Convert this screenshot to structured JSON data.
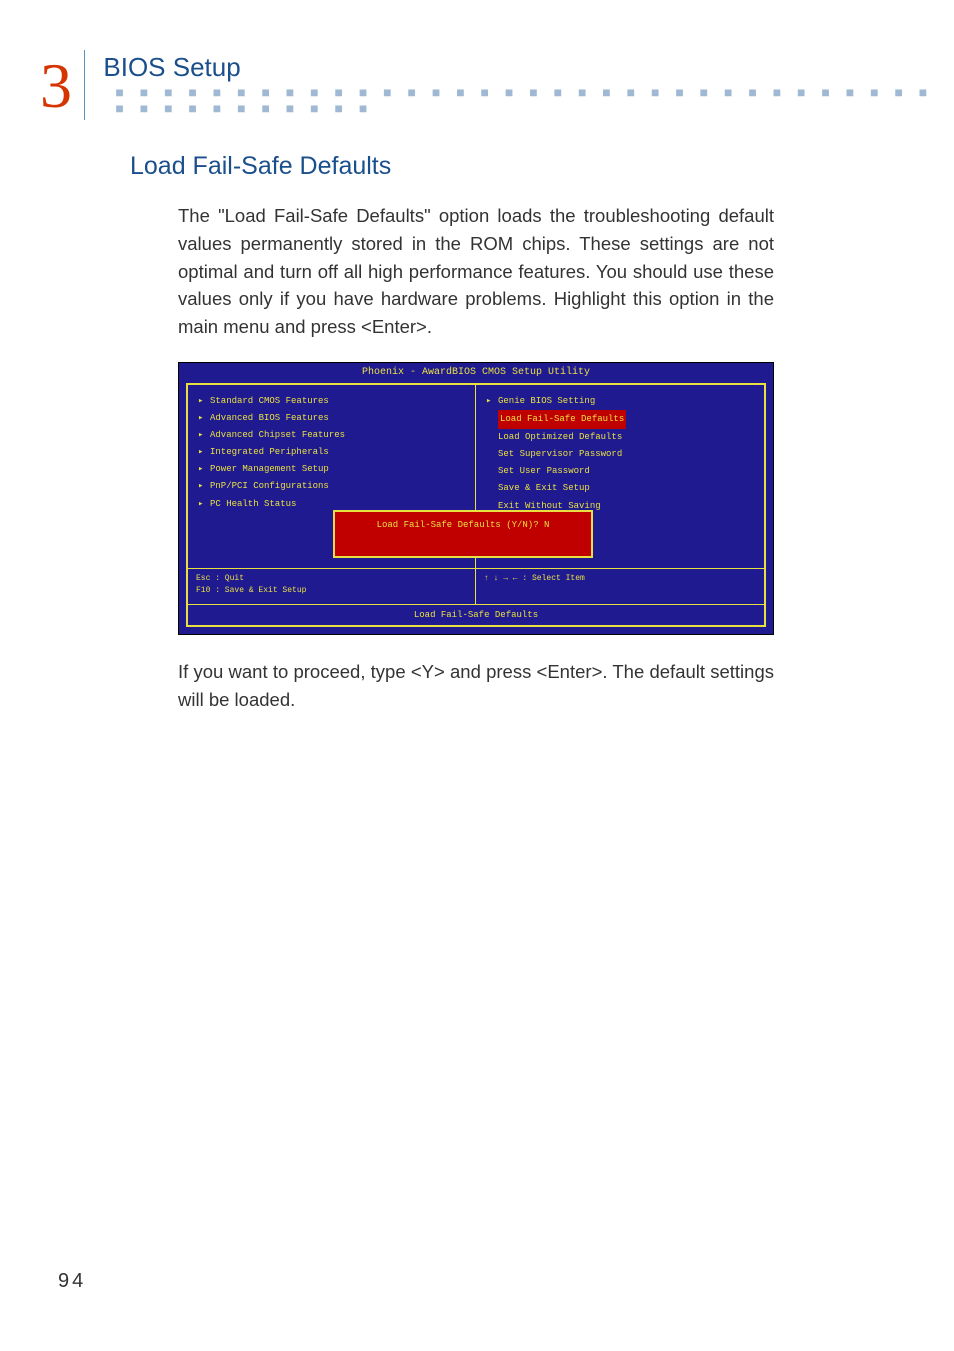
{
  "chapter": {
    "number": "3",
    "title": "BIOS Setup"
  },
  "section_title": "Load Fail-Safe Defaults",
  "paragraph_1": "The \"Load Fail-Safe Defaults\" option loads the troubleshooting default values permanently stored in the ROM chips. These settings are not optimal and turn off all high performance features. You should use these values only if you have hardware problems. Highlight this option in the main menu and press <Enter>.",
  "bios": {
    "title": "Phoenix - AwardBIOS CMOS Setup Utility",
    "left_items": [
      "Standard CMOS Features",
      "Advanced BIOS Features",
      "Advanced Chipset Features",
      "Integrated Peripherals",
      "Power Management Setup",
      "PnP/PCI Configurations",
      "PC Health Status"
    ],
    "right_items": [
      {
        "text": "Genie BIOS Setting",
        "arrow": true,
        "red": false
      },
      {
        "text": "Load Fail-Safe Defaults",
        "arrow": false,
        "red": true
      },
      {
        "text": "Load Optimized Defaults",
        "arrow": false,
        "red": false
      },
      {
        "text": "Set Supervisor Password",
        "arrow": false,
        "red": false
      },
      {
        "text": "Set User Password",
        "arrow": false,
        "red": false
      },
      {
        "text": "Save & Exit Setup",
        "arrow": false,
        "red": false
      },
      {
        "text": "Exit Without Saving",
        "arrow": false,
        "red": false
      }
    ],
    "dialog": {
      "line1": "Load Fail-Safe Defaults (Y/N)? N"
    },
    "nav": {
      "left_line1": "Esc : Quit",
      "left_line2": "F10 : Save & Exit Setup",
      "right_line1": "↑ ↓ → ←   : Select Item"
    },
    "footer": "Load Fail-Safe Defaults"
  },
  "paragraph_2": "If you want to proceed, type <Y> and press <Enter>. The default settings will be loaded.",
  "page_number": "94"
}
